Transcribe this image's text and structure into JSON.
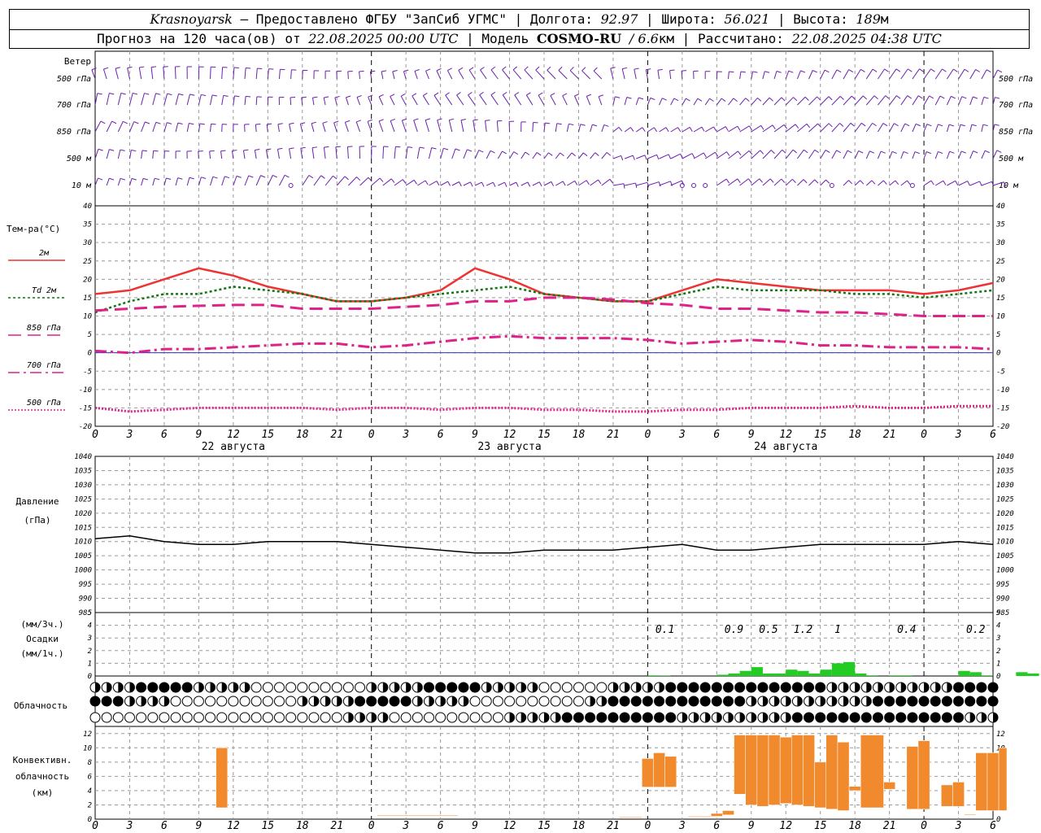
{
  "header": {
    "city": "Krasnoyarsk",
    "provider": "– Предоставлено ФГБУ \"ЗапСиб УГМС\"",
    "lon_label": "Долгота:",
    "lon": "92.97",
    "lat_label": "Широта:",
    "lat": "56.021",
    "alt_label": "Высота:",
    "alt": "189",
    "alt_unit": "м",
    "forecast_text": "Прогноз на 120 часа(ов) от",
    "forecast_time": "22.08.2025 00:00 UTC",
    "model_label": "Модель",
    "model": "COSMO-RU",
    "resolution": "/ 6.6",
    "resolution_unit": "км",
    "calc_label": "Рассчитано:",
    "calc_time": "22.08.2025 04:38 UTC"
  },
  "chart_data": [
    {
      "type": "wind-barbs",
      "title": "Ветер",
      "levels": [
        "500 гПа",
        "700 гПа",
        "850 гПа",
        "500 м",
        "10 м"
      ]
    },
    {
      "type": "line",
      "ylabel": "Тем-ра(°C)",
      "ylim": [
        -20,
        40
      ],
      "yticks": [
        -20,
        -15,
        -10,
        -5,
        0,
        5,
        10,
        15,
        20,
        25,
        30,
        35,
        40
      ],
      "x": [
        0,
        3,
        6,
        9,
        12,
        15,
        18,
        21,
        24,
        27,
        30,
        33,
        36,
        39,
        42,
        45,
        48,
        51,
        54,
        57,
        60,
        63,
        66,
        69,
        72,
        75,
        78
      ],
      "series": [
        {
          "name": "2м",
          "color": "#ee3333",
          "dash": "solid",
          "values": [
            16,
            17,
            20,
            23,
            21,
            18,
            16,
            14,
            14,
            15,
            17,
            23,
            20,
            16,
            15,
            14,
            14,
            17,
            20,
            19,
            18,
            17,
            17,
            17,
            16,
            17,
            19
          ]
        },
        {
          "name": "Td 2м",
          "color": "#117711",
          "dash": "dot",
          "values": [
            11,
            14,
            16,
            16,
            18,
            17,
            16,
            14,
            14,
            15,
            16,
            17,
            18,
            16,
            15,
            14,
            14,
            16,
            18,
            17,
            17,
            17,
            16,
            16,
            15,
            16,
            17
          ]
        },
        {
          "name": "850 гПа",
          "color": "#dd2288",
          "dash": "long",
          "values": [
            11.5,
            12,
            12.5,
            12.8,
            13,
            13,
            12,
            12,
            12,
            12.5,
            13,
            14,
            14,
            15,
            15,
            14.5,
            13.5,
            13,
            12,
            12,
            11.5,
            11,
            11,
            10.5,
            10,
            10,
            10
          ]
        },
        {
          "name": "700 гПа",
          "color": "#dd2288",
          "dash": "dashdot",
          "values": [
            0.5,
            0,
            1,
            1,
            1.5,
            2,
            2.5,
            2.5,
            1.5,
            2,
            3,
            4,
            4.5,
            4,
            4,
            4,
            3.5,
            2.5,
            3,
            3.5,
            3,
            2,
            2,
            1.5,
            1.5,
            1.5,
            1
          ]
        },
        {
          "name": "500 гПа",
          "color": "#dd2288",
          "dash": "fine",
          "values": [
            -15,
            -16,
            -15.5,
            -15,
            -15,
            -15,
            -15,
            -15.5,
            -15,
            -15,
            -15.5,
            -15,
            -15,
            -15.5,
            -15.5,
            -16,
            -16,
            -15.5,
            -15.5,
            -15,
            -15,
            -15,
            -14.5,
            -15,
            -15,
            -14.5,
            -14.5
          ]
        }
      ]
    },
    {
      "type": "line",
      "ylabel": "Давление",
      "yunit": "(гПа)",
      "ylim": [
        985,
        1040
      ],
      "yticks": [
        985,
        990,
        995,
        1000,
        1005,
        1010,
        1015,
        1020,
        1025,
        1030,
        1035,
        1040
      ],
      "x": [
        0,
        3,
        6,
        9,
        12,
        15,
        18,
        21,
        24,
        27,
        30,
        33,
        36,
        39,
        42,
        45,
        48,
        51,
        54,
        57,
        60,
        63,
        66,
        69,
        72,
        75,
        78
      ],
      "series": [
        {
          "name": "Давление",
          "color": "#000000",
          "values": [
            1011,
            1012,
            1010,
            1009,
            1009,
            1010,
            1010,
            1010,
            1009,
            1008,
            1007,
            1006,
            1006,
            1007,
            1007,
            1007,
            1008,
            1009,
            1007,
            1007,
            1008,
            1009,
            1009,
            1009,
            1009,
            1010,
            1009
          ]
        }
      ]
    },
    {
      "type": "bar",
      "ylabel": "Осадки",
      "yunit_top": "(мм/3ч.)",
      "yunit_bottom": "(мм/1ч.)",
      "ylim": [
        0,
        5
      ],
      "yticks": [
        0,
        1,
        2,
        3,
        4,
        5
      ],
      "bars_hour": [
        48,
        49,
        54,
        55,
        56,
        57,
        58,
        59,
        60,
        61,
        62,
        63,
        64,
        65,
        66,
        67,
        69,
        70,
        75,
        76,
        77,
        80,
        81
      ],
      "bars_value": [
        0.05,
        0.02,
        0.1,
        0.2,
        0.4,
        0.7,
        0.2,
        0.2,
        0.5,
        0.4,
        0.2,
        0.5,
        1.0,
        1.1,
        0.2,
        0.05,
        0.05,
        0.05,
        0.4,
        0.3,
        0.05,
        0.3,
        0.2
      ],
      "totals": [
        {
          "hour": 49.5,
          "text": "0.1"
        },
        {
          "hour": 55.5,
          "text": "0.9"
        },
        {
          "hour": 58.5,
          "text": "0.5"
        },
        {
          "hour": 61.5,
          "text": "1.2"
        },
        {
          "hour": 64.5,
          "text": "1"
        },
        {
          "hour": 70.5,
          "text": "0.4"
        },
        {
          "hour": 76.5,
          "text": "0.2"
        }
      ]
    },
    {
      "type": "symbols",
      "ylabel": "Облачность",
      "rows": [
        "upper",
        "middle",
        "lower"
      ]
    },
    {
      "type": "bar",
      "ylabel": "Конвективн. облачность (км)",
      "ylim": [
        0,
        13
      ],
      "yticks": [
        0,
        2,
        4,
        6,
        8,
        10,
        12
      ],
      "ranges": [
        {
          "h0": 10.5,
          "h1": 11.5,
          "base": 1.6,
          "top": 10
        },
        {
          "h0": 24.5,
          "h1": 31.5,
          "base": 0.5,
          "top": 0.6
        },
        {
          "h0": 45.5,
          "h1": 47.5,
          "base": 0.2,
          "top": 0.3
        },
        {
          "h0": 47.5,
          "h1": 48.5,
          "base": 4.5,
          "top": 8.5
        },
        {
          "h0": 48.5,
          "h1": 49.5,
          "base": 4.5,
          "top": 9.3
        },
        {
          "h0": 49.5,
          "h1": 50.5,
          "base": 4.5,
          "top": 8.8
        },
        {
          "h0": 51.5,
          "h1": 53.5,
          "base": 0.3,
          "top": 0.4
        },
        {
          "h0": 53.5,
          "h1": 54.5,
          "base": 0.4,
          "top": 0.8
        },
        {
          "h0": 54.5,
          "h1": 55.5,
          "base": 0.6,
          "top": 1.2
        },
        {
          "h0": 55.5,
          "h1": 56.5,
          "base": 3.5,
          "top": 11.8
        },
        {
          "h0": 56.5,
          "h1": 57.5,
          "base": 2.0,
          "top": 11.8
        },
        {
          "h0": 57.5,
          "h1": 58.5,
          "base": 1.8,
          "top": 11.8
        },
        {
          "h0": 58.5,
          "h1": 59.5,
          "base": 2.0,
          "top": 11.8
        },
        {
          "h0": 59.5,
          "h1": 60.5,
          "base": 2.2,
          "top": 11.5
        },
        {
          "h0": 60.5,
          "h1": 61.5,
          "base": 2.0,
          "top": 11.8
        },
        {
          "h0": 61.5,
          "h1": 62.5,
          "base": 1.8,
          "top": 11.8
        },
        {
          "h0": 62.5,
          "h1": 63.5,
          "base": 1.6,
          "top": 8.0
        },
        {
          "h0": 63.5,
          "h1": 64.5,
          "base": 1.4,
          "top": 11.8
        },
        {
          "h0": 64.5,
          "h1": 65.5,
          "base": 1.2,
          "top": 10.8
        },
        {
          "h0": 65.5,
          "h1": 66.5,
          "base": 4.0,
          "top": 4.6
        },
        {
          "h0": 66.5,
          "h1": 68.5,
          "base": 1.6,
          "top": 11.8
        },
        {
          "h0": 68.5,
          "h1": 69.5,
          "base": 4.2,
          "top": 5.2
        },
        {
          "h0": 70.5,
          "h1": 71.5,
          "base": 1.4,
          "top": 10.2
        },
        {
          "h0": 71.5,
          "h1": 72.5,
          "base": 1.4,
          "top": 11.0
        },
        {
          "h0": 73.5,
          "h1": 74.5,
          "base": 1.8,
          "top": 4.8
        },
        {
          "h0": 74.5,
          "h1": 75.5,
          "base": 1.8,
          "top": 5.2
        },
        {
          "h0": 75.5,
          "h1": 76.5,
          "base": 0.6,
          "top": 0.7
        },
        {
          "h0": 76.5,
          "h1": 77.5,
          "base": 1.2,
          "top": 9.3
        },
        {
          "h0": 77.5,
          "h1": 78.5,
          "base": 1.2,
          "top": 9.3
        },
        {
          "h0": 78.5,
          "h1": 79.2,
          "base": 1.2,
          "top": 10.0
        }
      ]
    }
  ],
  "x_axis": {
    "tick_labels": [
      "0",
      "3",
      "6",
      "9",
      "12",
      "15",
      "18",
      "21",
      "0",
      "3",
      "6",
      "9",
      "12",
      "15",
      "18",
      "21",
      "0",
      "3",
      "6",
      "9",
      "12",
      "15",
      "18",
      "21",
      "0",
      "3",
      "6"
    ],
    "days": [
      {
        "hour": 12,
        "label": "22 августа"
      },
      {
        "hour": 36,
        "label": "23 августа"
      },
      {
        "hour": 60,
        "label": "24 августа"
      }
    ]
  },
  "colors": {
    "barbs": "#6a1fb0",
    "precip": "#22cc22",
    "convective": "#f08a2c",
    "grid": "#999999",
    "zero_line": "#3333cc"
  }
}
